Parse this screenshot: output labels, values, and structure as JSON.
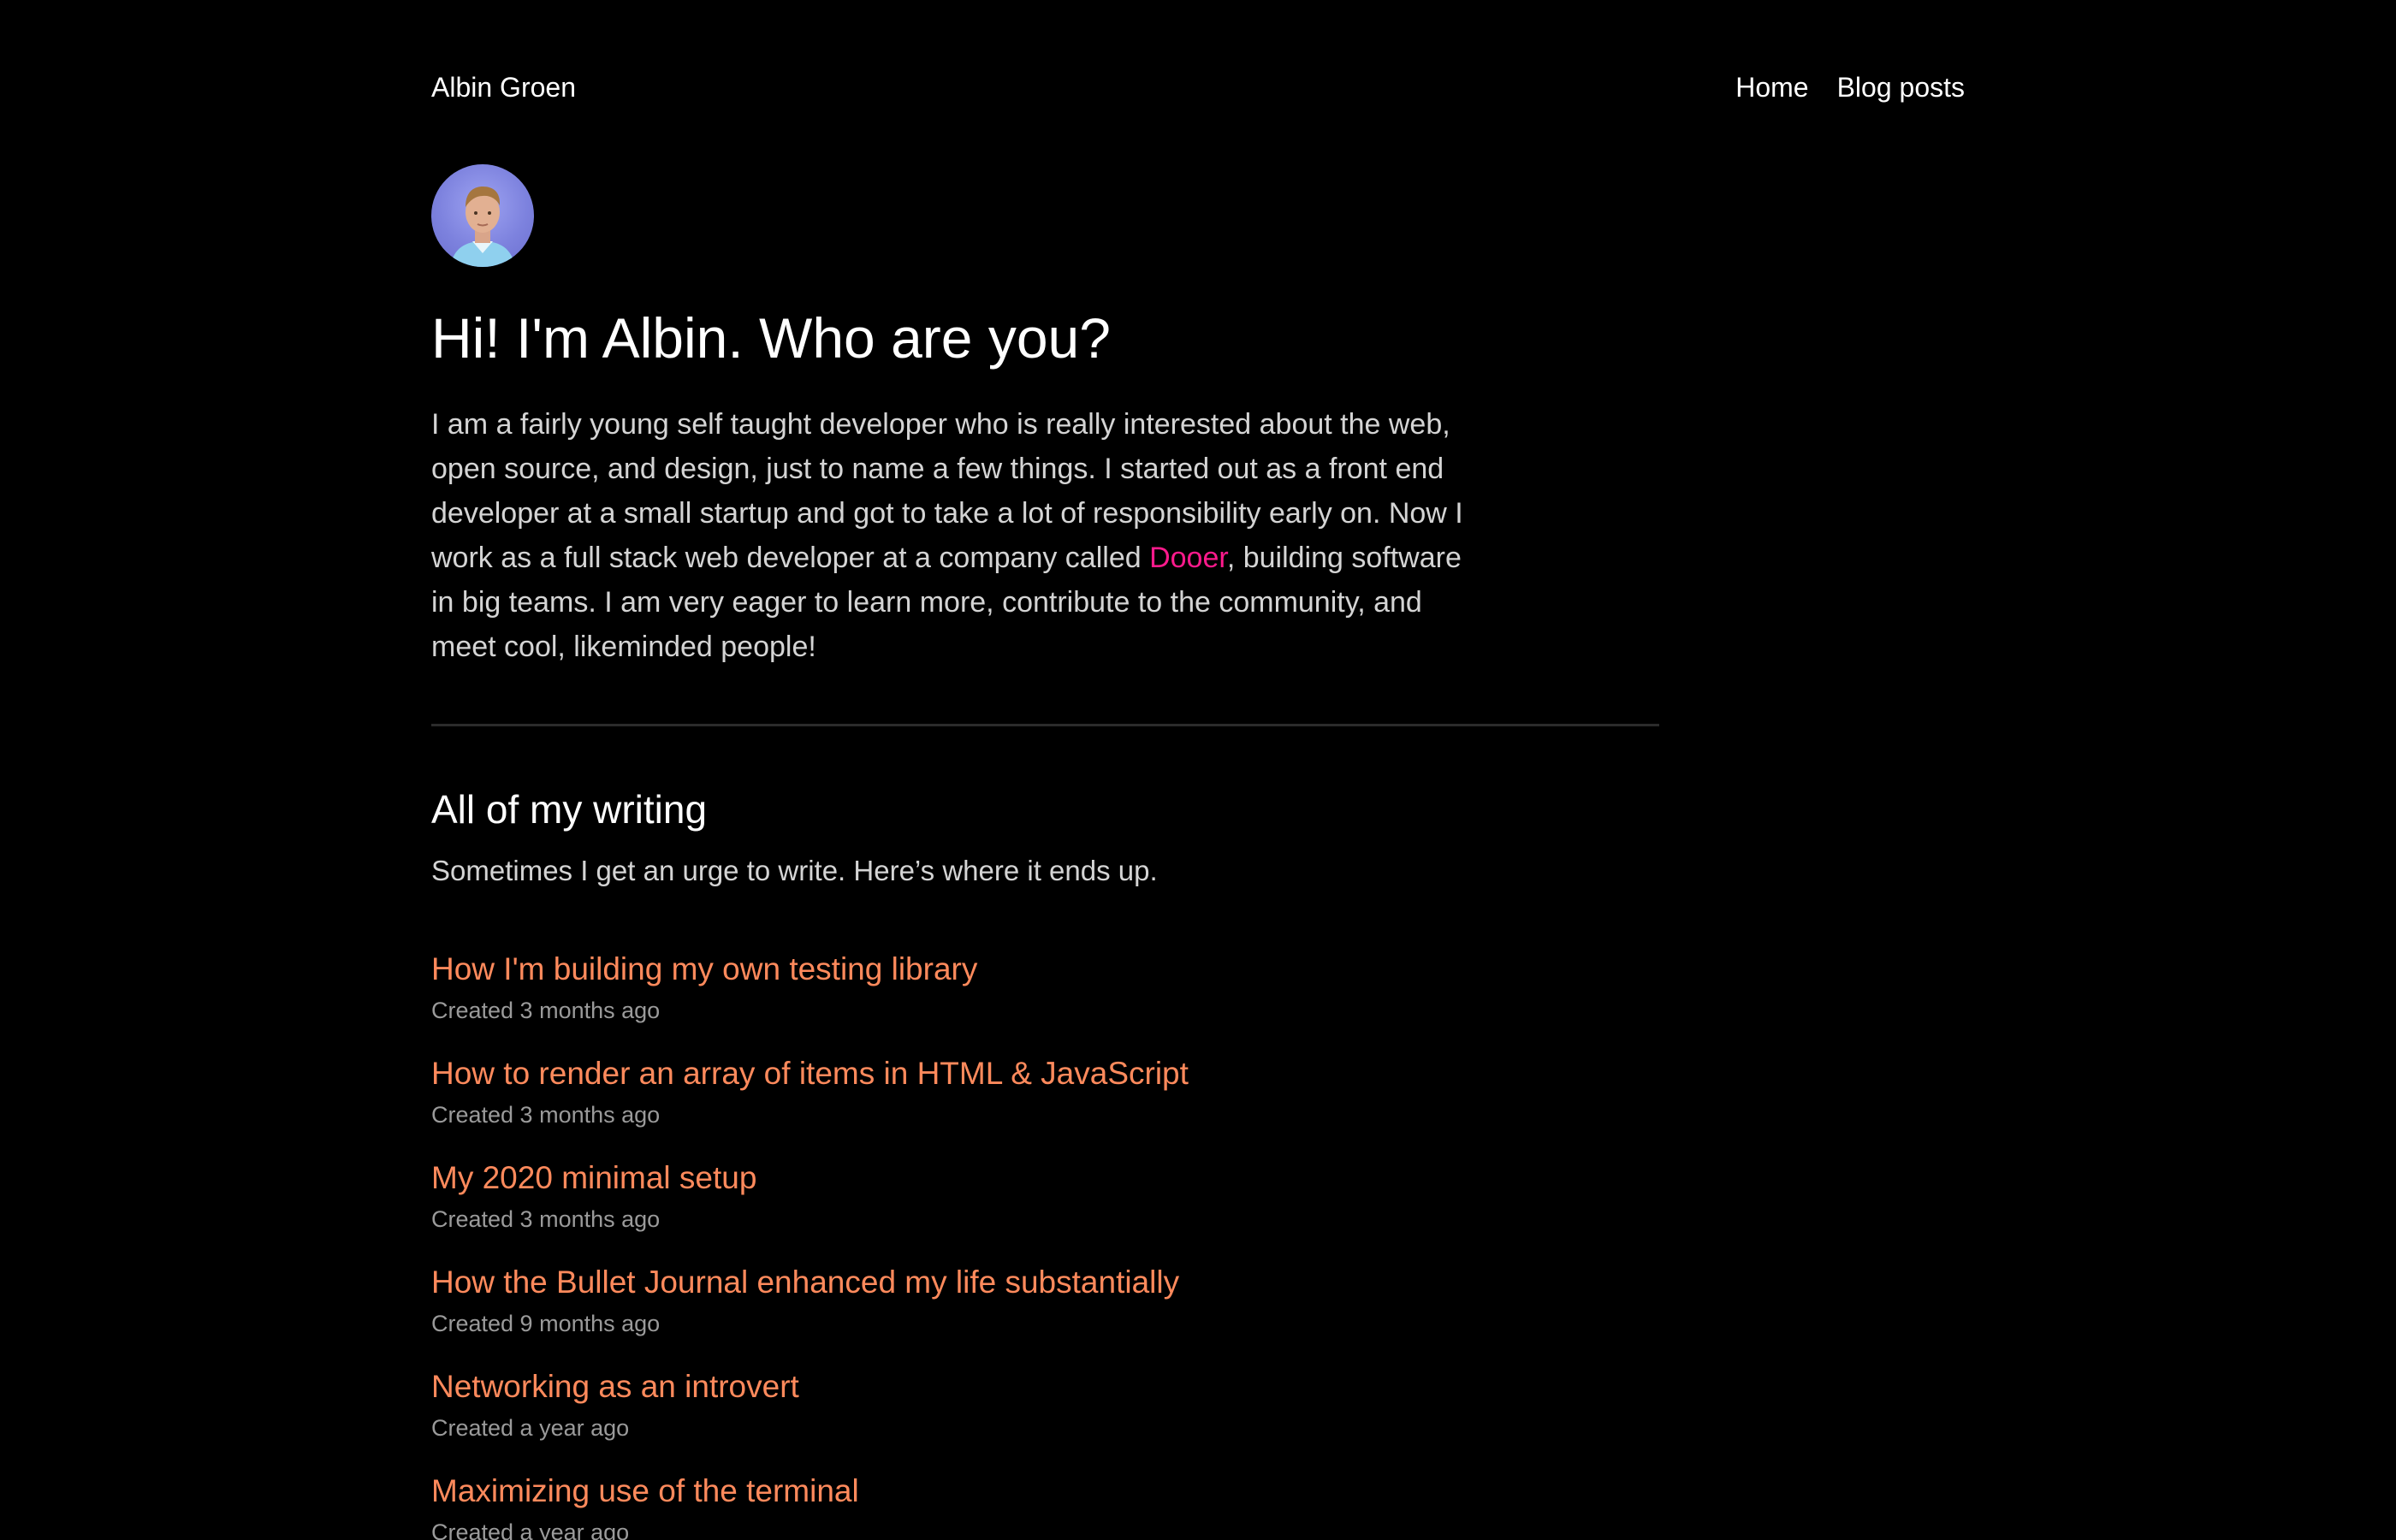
{
  "header": {
    "site_title": "Albin Groen",
    "nav": [
      "Home",
      "Blog posts"
    ]
  },
  "hero": {
    "title": "Hi! I'm Albin. Who are you?",
    "bio_before": "I am a fairly young self taught developer who is really interested about the web, open source, and design, just to name a few things. I started out as a front end developer at a small startup and got to take a lot of responsibility early on. Now I work as a full stack web developer at a company called ",
    "bio_link": "Dooer",
    "bio_after": ", building software in big teams. I am very eager to learn more, contribute to the community, and meet cool, likeminded people!"
  },
  "writing": {
    "title": "All of my writing",
    "subtitle": "Sometimes I get an urge to write. Here’s where it ends up.",
    "posts": [
      {
        "title": "How I'm building my own testing library",
        "date": "Created 3 months ago"
      },
      {
        "title": "How to render an array of items in HTML & JavaScript",
        "date": "Created 3 months ago"
      },
      {
        "title": "My 2020 minimal setup",
        "date": "Created 3 months ago"
      },
      {
        "title": "How the Bullet Journal enhanced my life substantially",
        "date": "Created 9 months ago"
      },
      {
        "title": "Networking as an introvert",
        "date": "Created a year ago"
      },
      {
        "title": "Maximizing use of the terminal",
        "date": "Created a year ago"
      }
    ]
  },
  "colors": {
    "background": "#000000",
    "post_link": "#ff8a5c",
    "inline_link": "#ff1a8c",
    "muted": "#9a9a9a"
  }
}
